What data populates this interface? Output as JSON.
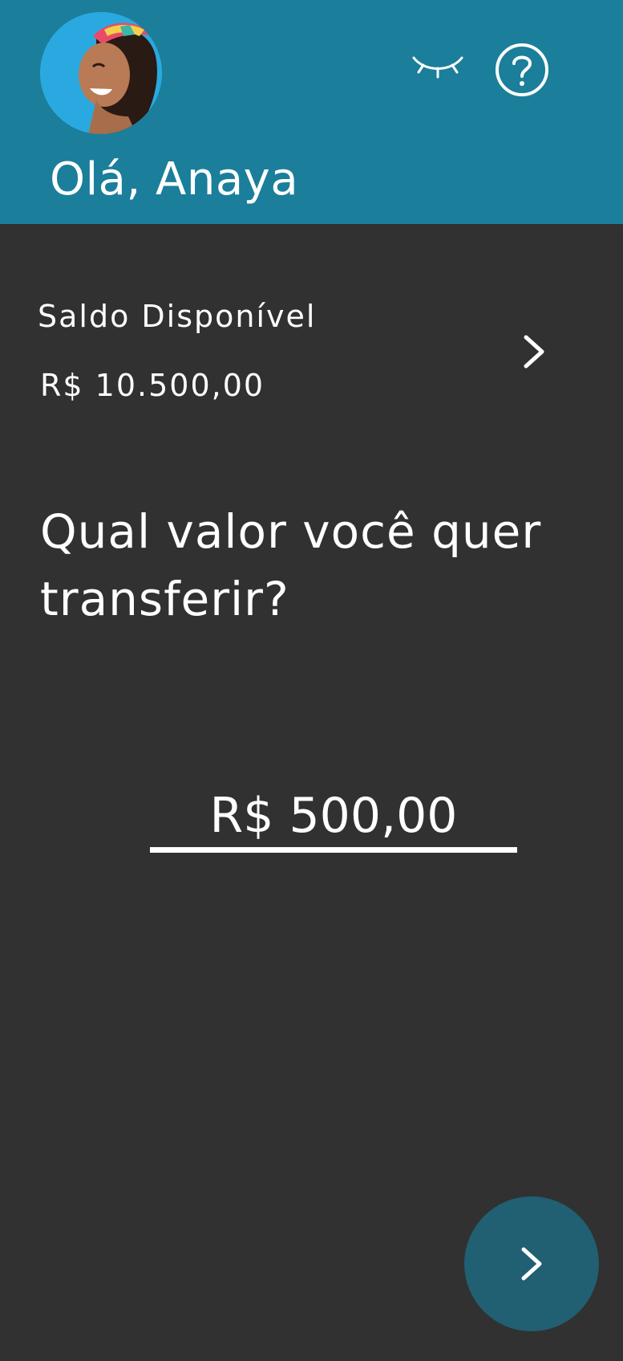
{
  "header": {
    "greeting": "Olá, Anaya",
    "avatar_icon": "profile-avatar",
    "hide_balance_icon": "eye-closed-icon",
    "help_icon": "help-circle-icon",
    "background_color": "#1b7e9b"
  },
  "balance": {
    "label": "Saldo Disponível",
    "value": "R$ 10.500,00",
    "detail_icon": "chevron-right-icon"
  },
  "transfer": {
    "question": "Qual valor você quer transferir?",
    "amount": "R$ 500,00"
  },
  "next_button": {
    "icon": "chevron-right-icon",
    "background_color": "#215f72"
  }
}
